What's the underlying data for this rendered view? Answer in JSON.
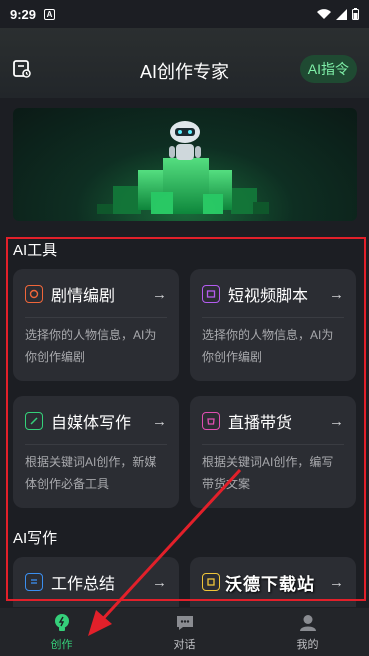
{
  "status": {
    "time": "9:29",
    "notif_glyph": "A"
  },
  "header": {
    "title": "AI创作专家",
    "command_button": "AI指令",
    "left_icon": "history-icon"
  },
  "banner": {
    "image": "robot-on-green-cubes"
  },
  "sections": [
    {
      "title": "AI工具",
      "cards": [
        {
          "title": "剧情编剧",
          "arrow": "→",
          "desc": "选择你的人物信息，AI为你创作编剧",
          "icon": "script-icon",
          "color": "#f0663a"
        },
        {
          "title": "短视频脚本",
          "arrow": "→",
          "desc": "选择你的人物信息，AI为你创作编剧",
          "icon": "video-icon",
          "color": "#b45cf0"
        },
        {
          "title": "自媒体写作",
          "arrow": "→",
          "desc": "根据关键词AI创作，新媒体创作必备工具",
          "icon": "pencil-icon",
          "color": "#34d17a"
        },
        {
          "title": "直播带货",
          "arrow": "→",
          "desc": "根据关键词AI创作，编写带货文案",
          "icon": "shop-icon",
          "color": "#e04fb2"
        }
      ]
    },
    {
      "title": "AI写作",
      "cards": [
        {
          "title": "工作总结",
          "arrow": "→",
          "icon": "report-icon",
          "color": "#3b8ff0"
        },
        {
          "title": "",
          "arrow": "→",
          "icon": "document-icon",
          "color": "#f0c63a"
        }
      ]
    }
  ],
  "watermark": "沃德下载站",
  "tabs": [
    {
      "label": "创作",
      "icon": "bulb-icon",
      "active": true
    },
    {
      "label": "对话",
      "icon": "chat-icon",
      "active": false
    },
    {
      "label": "我的",
      "icon": "user-icon",
      "active": false
    }
  ],
  "colors": {
    "accent_green": "#35d07a",
    "annotation_red": "#e2202a"
  }
}
